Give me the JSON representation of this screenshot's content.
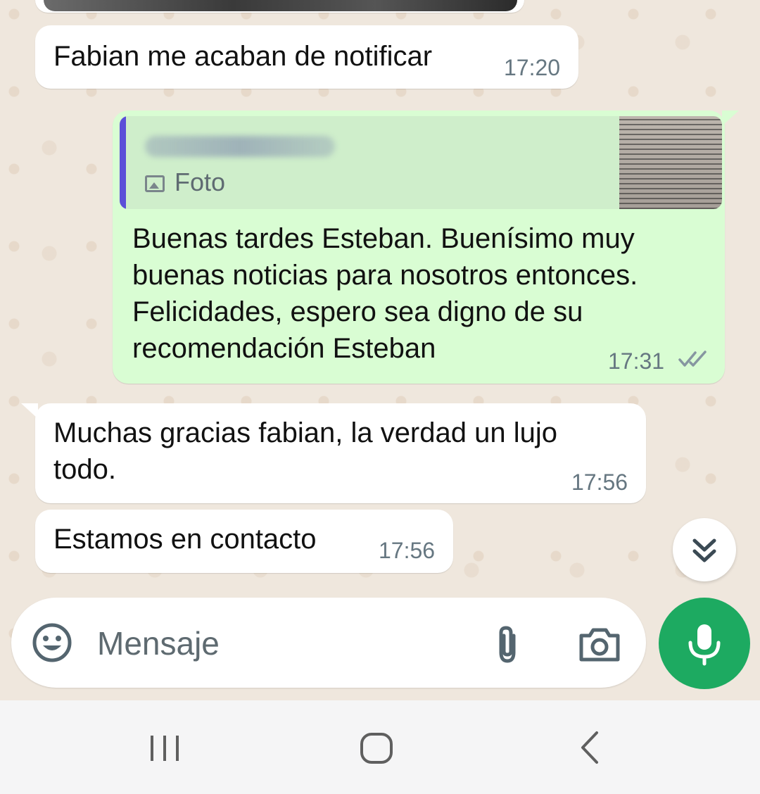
{
  "messages": [
    {
      "direction": "in",
      "text": "Fabian me acaban de notificar",
      "time": "17:20"
    },
    {
      "direction": "out",
      "quoted": {
        "type_label": "Foto"
      },
      "text": "Buenas tardes Esteban. Buenísimo muy\nbuenas noticias para nosotros entonces.\nFelicidades, espero sea digno de su\nrecomendación Esteban",
      "time": "17:31",
      "status": "read"
    },
    {
      "direction": "in",
      "text": "Muchas gracias fabian, la verdad un lujo\ntodo.",
      "time": "17:56"
    },
    {
      "direction": "in",
      "text": "Estamos en contacto",
      "time": "17:56"
    }
  ],
  "composer": {
    "placeholder": "Mensaje"
  },
  "icons": {
    "emoji": "emoji-icon",
    "attach": "paperclip-icon",
    "camera": "camera-icon",
    "mic": "mic-icon",
    "scroll_down": "double-chevron-down-icon",
    "read_receipt": "double-check-icon"
  },
  "colors": {
    "outgoing_bubble": "#d9fdd3",
    "incoming_bubble": "#ffffff",
    "accent_green": "#1daa61",
    "quote_bar": "#5b4fd8"
  }
}
